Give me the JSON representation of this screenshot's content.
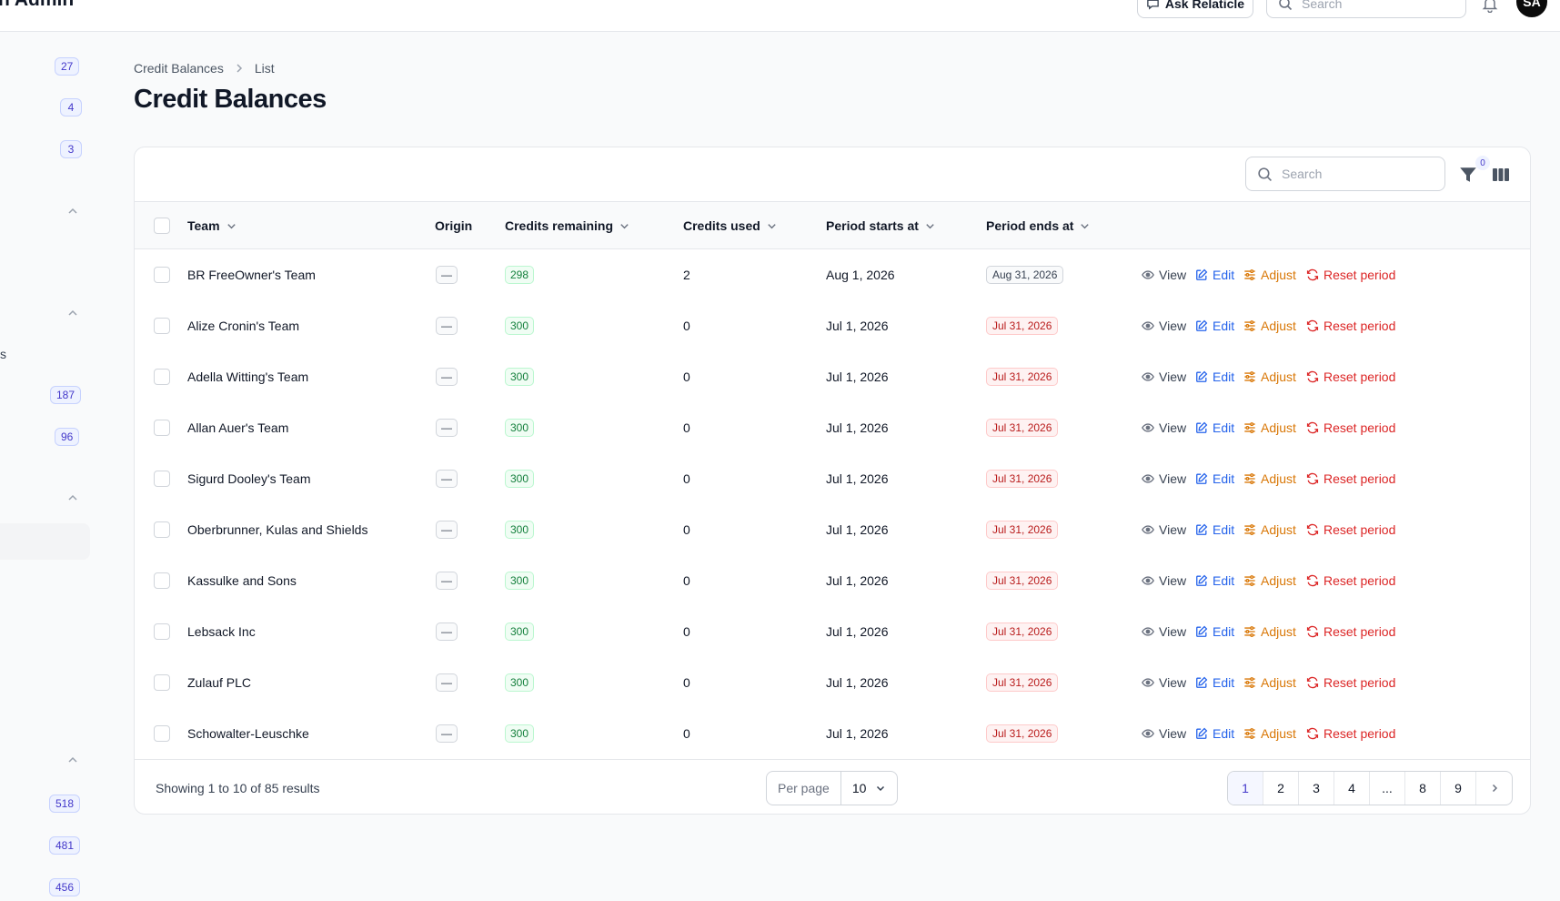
{
  "app": {
    "brand": "n Admin",
    "ask_label": "Ask Relaticle",
    "search_placeholder": "Search",
    "avatar_initials": "SA"
  },
  "sidebar": {
    "badges": [
      "27",
      "4",
      "3",
      "187",
      "96",
      "518",
      "481",
      "456"
    ],
    "letter": "s"
  },
  "breadcrumb": {
    "parent": "Credit Balances",
    "current": "List"
  },
  "page": {
    "title": "Credit Balances"
  },
  "table": {
    "search_placeholder": "Search",
    "filter_count": "0",
    "columns": {
      "team": "Team",
      "origin": "Origin",
      "credits_remaining": "Credits remaining",
      "credits_used": "Credits used",
      "period_starts": "Period starts at",
      "period_ends": "Period ends at"
    },
    "actions": {
      "view": "View",
      "edit": "Edit",
      "adjust": "Adjust",
      "reset": "Reset period"
    },
    "rows": [
      {
        "team": "BR FreeOwner's Team",
        "origin": "—",
        "remaining": "298",
        "used": "2",
        "starts": "Aug 1, 2026",
        "ends": "Aug 31, 2026",
        "ends_status": "gray"
      },
      {
        "team": "Alize Cronin's Team",
        "origin": "—",
        "remaining": "300",
        "used": "0",
        "starts": "Jul 1, 2026",
        "ends": "Jul 31, 2026",
        "ends_status": "red"
      },
      {
        "team": "Adella Witting's Team",
        "origin": "—",
        "remaining": "300",
        "used": "0",
        "starts": "Jul 1, 2026",
        "ends": "Jul 31, 2026",
        "ends_status": "red"
      },
      {
        "team": "Allan Auer's Team",
        "origin": "—",
        "remaining": "300",
        "used": "0",
        "starts": "Jul 1, 2026",
        "ends": "Jul 31, 2026",
        "ends_status": "red"
      },
      {
        "team": "Sigurd Dooley's Team",
        "origin": "—",
        "remaining": "300",
        "used": "0",
        "starts": "Jul 1, 2026",
        "ends": "Jul 31, 2026",
        "ends_status": "red"
      },
      {
        "team": "Oberbrunner, Kulas and Shields",
        "origin": "—",
        "remaining": "300",
        "used": "0",
        "starts": "Jul 1, 2026",
        "ends": "Jul 31, 2026",
        "ends_status": "red"
      },
      {
        "team": "Kassulke and Sons",
        "origin": "—",
        "remaining": "300",
        "used": "0",
        "starts": "Jul 1, 2026",
        "ends": "Jul 31, 2026",
        "ends_status": "red"
      },
      {
        "team": "Lebsack Inc",
        "origin": "—",
        "remaining": "300",
        "used": "0",
        "starts": "Jul 1, 2026",
        "ends": "Jul 31, 2026",
        "ends_status": "red"
      },
      {
        "team": "Zulauf PLC",
        "origin": "—",
        "remaining": "300",
        "used": "0",
        "starts": "Jul 1, 2026",
        "ends": "Jul 31, 2026",
        "ends_status": "red"
      },
      {
        "team": "Schowalter-Leuschke",
        "origin": "—",
        "remaining": "300",
        "used": "0",
        "starts": "Jul 1, 2026",
        "ends": "Jul 31, 2026",
        "ends_status": "red"
      }
    ]
  },
  "footer": {
    "showing": "Showing 1 to 10 of 85 results",
    "per_page_label": "Per page",
    "per_page_value": "10",
    "pages": [
      "1",
      "2",
      "3",
      "4",
      "...",
      "8",
      "9"
    ],
    "current_page": "1"
  },
  "colors": {
    "accent": "#4338ca",
    "edit": "#2563eb",
    "adjust": "#d97706",
    "reset": "#dc2626",
    "success": "#15803d"
  }
}
